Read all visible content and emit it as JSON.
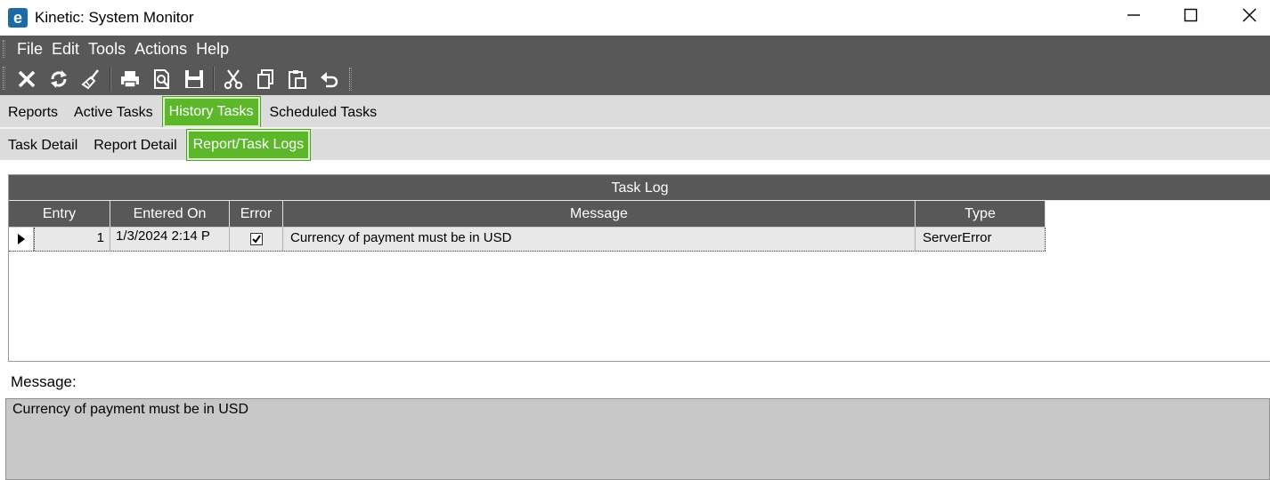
{
  "window": {
    "title": "Kinetic: System Monitor",
    "logo_letter": "e",
    "logo_color": "#1b6aa5"
  },
  "menu": {
    "items": [
      "File",
      "Edit",
      "Tools",
      "Actions",
      "Help"
    ]
  },
  "toolbar": {
    "buttons": [
      "clear-icon",
      "refresh-icon",
      "sweep-icon",
      "print-icon",
      "print-preview-icon",
      "save-icon",
      "cut-icon",
      "copy-icon",
      "paste-icon",
      "undo-icon"
    ]
  },
  "tabs_primary": {
    "items": [
      "Reports",
      "Active Tasks",
      "History Tasks",
      "Scheduled Tasks"
    ],
    "active": "History Tasks"
  },
  "tabs_secondary": {
    "items": [
      "Task Detail",
      "Report Detail",
      "Report/Task Logs"
    ],
    "active": "Report/Task Logs"
  },
  "task_log": {
    "caption": "Task Log",
    "columns": [
      "Entry",
      "Entered On",
      "Error",
      "Message",
      "Type"
    ],
    "rows": [
      {
        "entry": "1",
        "entered_on": "1/3/2024 2:14 P",
        "error": true,
        "message": "Currency of payment must be in USD",
        "type": "ServerError"
      }
    ]
  },
  "message_panel": {
    "label": "Message:",
    "value": "Currency of payment must be in USD"
  },
  "colors": {
    "accent_green": "#5cb82a",
    "dark_bar": "#585858",
    "tab_bg": "#dcdcdc"
  }
}
